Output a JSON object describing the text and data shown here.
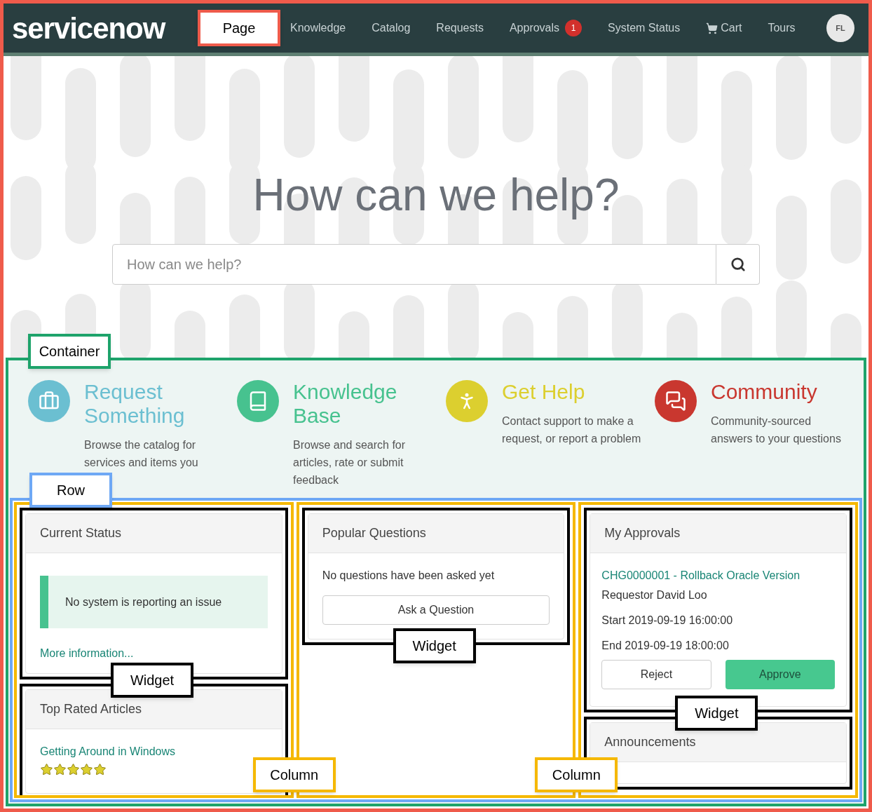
{
  "header": {
    "logo": "servicenow",
    "page_label": "Page",
    "nav": [
      {
        "label": "Knowledge",
        "kind": "link"
      },
      {
        "label": "Catalog",
        "kind": "link"
      },
      {
        "label": "Requests",
        "kind": "link"
      },
      {
        "label": "Approvals",
        "kind": "link",
        "badge": "1"
      },
      {
        "label": "System Status",
        "kind": "link"
      },
      {
        "label": "Cart",
        "kind": "cart"
      },
      {
        "label": "Tours",
        "kind": "link"
      }
    ],
    "avatar": "FL"
  },
  "hero": {
    "title": "How can we help?",
    "search": {
      "placeholder": "How can we help?"
    }
  },
  "container": {
    "label": "Container",
    "categories": [
      {
        "kind": "briefcase",
        "title": "Request Something",
        "description": "Browse the catalog for services and items you",
        "color": "#6bbfd1"
      },
      {
        "kind": "book",
        "title": "Knowledge Base",
        "description": "Browse and search for articles, rate or submit feedback",
        "color": "#47c28f"
      },
      {
        "kind": "person",
        "title": "Get Help",
        "description": "Contact support to make a request, or report a problem",
        "color": "#dccf2f"
      },
      {
        "kind": "chat",
        "title": "Community",
        "description": "Community-sourced answers to your questions",
        "color": "#c9372f"
      }
    ]
  },
  "row": {
    "label": "Row",
    "columns": [
      {
        "label": "Column",
        "widgets": [
          {
            "kind": "status",
            "label": "Widget",
            "title": "Current Status",
            "message": "No system is reporting an issue",
            "link": "More information..."
          },
          {
            "kind": "articles",
            "title": "Top Rated Articles",
            "articles": [
              {
                "title": "Getting Around in Windows",
                "stars": 5
              }
            ]
          }
        ]
      },
      {
        "label": "Column",
        "widgets": [
          {
            "kind": "questions",
            "label": "Widget",
            "title": "Popular Questions",
            "message": "No questions have been asked yet",
            "button": "Ask a Question"
          }
        ]
      },
      {
        "widgets": [
          {
            "kind": "approvals",
            "label": "Widget",
            "title": "My Approvals",
            "link": "CHG0000001 - Rollback Oracle Version",
            "lines": [
              "Requestor David Loo",
              "Start 2019-09-19 16:00:00",
              "End 2019-09-19 18:00:00"
            ],
            "reject": "Reject",
            "approve": "Approve"
          },
          {
            "kind": "announcements",
            "title": "Announcements"
          }
        ]
      }
    ]
  }
}
